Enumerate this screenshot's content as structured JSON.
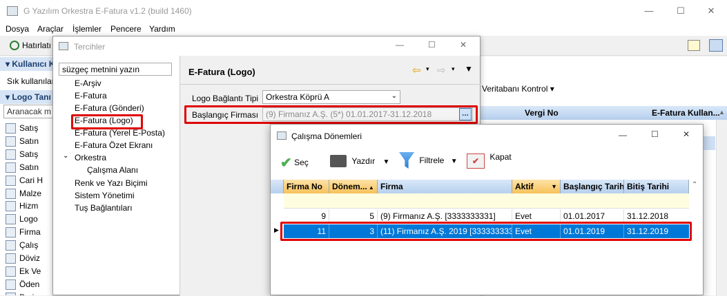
{
  "main": {
    "title": "G Yazılım Orkestra E-Fatura v1.2 (build 1460)",
    "menu": [
      "Dosya",
      "Araçlar",
      "İşlemler",
      "Pencere",
      "Yardım"
    ],
    "toolbar_reminder": "Hatırlatı",
    "left_sections": [
      "Kullanıcı K",
      "Logo Tanı"
    ],
    "sik_kullanilan": "Sık kullanılar",
    "search_placeholder": "Aranacak m",
    "left_items": [
      "Satış",
      "Satın",
      "Satış",
      "Satın",
      "Cari H",
      "Malze",
      "Hizm",
      "Logo",
      "Firma",
      "Çalış",
      "Döviz",
      "Ek Ve",
      "Öden",
      "Proje"
    ],
    "right_toolbar": "Veritabanı Kontrol",
    "right_columns": [
      "Vergi No",
      "E-Fatura Kullan..."
    ]
  },
  "tercihler": {
    "title": "Tercihler",
    "filter_placeholder": "süzgeç metnini yazın",
    "tree": [
      "E-Arşiv",
      "E-Fatura",
      "E-Fatura (Gönderi)",
      "E-Fatura (Logo)",
      "E-Fatura (Yerel E-Posta)",
      "E-Fatura Özet Ekranı",
      "Orkestra",
      "Çalışma Alanı",
      "Renk ve Yazı Biçimi",
      "Sistem Yönetimi",
      "Tuş Bağlantıları"
    ],
    "panel_title": "E-Fatura (Logo)",
    "connection_label": "Logo Bağlantı Tipi",
    "connection_value": "Orkestra Köprü A",
    "firm_label": "Başlangıç Firması",
    "firm_value": "(9) Firmanız A.Ş.  (5*)  01.01.2017-31.12.2018",
    "browse_label": "..."
  },
  "donem": {
    "title": "Çalışma Dönemleri",
    "buttons": {
      "sec": "Seç",
      "yazdir": "Yazdır",
      "filtrele": "Filtrele",
      "kapat": "Kapat"
    },
    "columns": [
      "Firma No",
      "Dönem...",
      "Firma",
      "Aktif",
      "Başlangıç Tarihi",
      "Bitiş Tarihi"
    ],
    "rows": [
      {
        "firma_no": "9",
        "donem": "5",
        "firma": "(9) Firmanız A.Ş. [3333333331]",
        "aktif": "Evet",
        "baslangic": "01.01.2017",
        "bitis": "31.12.2018"
      },
      {
        "firma_no": "11",
        "donem": "3",
        "firma": "(11) Firmanız A.Ş. 2019 [3333333331]",
        "aktif": "Evet",
        "baslangic": "01.01.2019",
        "bitis": "31.12.2019"
      }
    ]
  },
  "colors": {
    "accent": "#0078d7",
    "highlight": "#e00000",
    "selection": "#0078d7"
  }
}
